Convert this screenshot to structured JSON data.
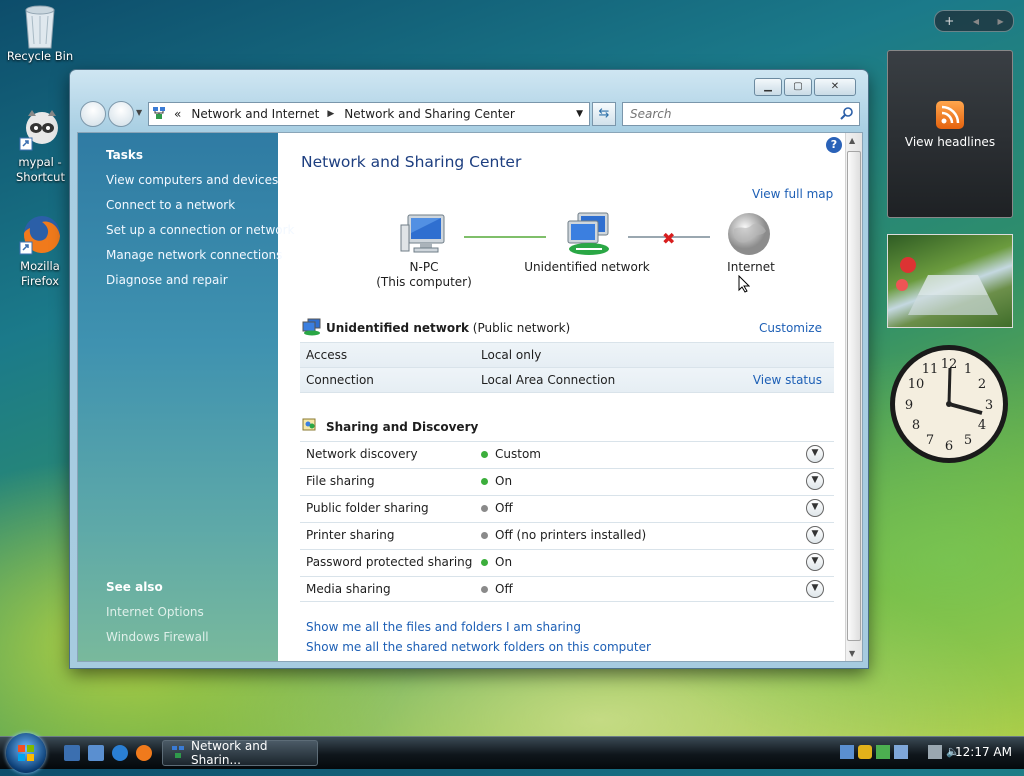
{
  "desktop": {
    "icons": [
      {
        "label": "Recycle Bin"
      },
      {
        "label": "mypal - Shortcut"
      },
      {
        "label": "Mozilla Firefox"
      }
    ]
  },
  "window": {
    "address": {
      "overflow": "«",
      "crumb1": "Network and Internet",
      "crumb2": "Network and Sharing Center"
    },
    "search_placeholder": "Search",
    "sidebar": {
      "tasks_header": "Tasks",
      "tasks": [
        "View computers and devices",
        "Connect to a network",
        "Set up a connection or network",
        "Manage network connections",
        "Diagnose and repair"
      ],
      "see_also_header": "See also",
      "see_also": [
        "Internet Options",
        "Windows Firewall"
      ]
    },
    "main": {
      "title": "Network and Sharing Center",
      "view_full_map": "View full map",
      "map": {
        "computer_name": "N-PC",
        "computer_sub": "(This computer)",
        "network": "Unidentified network",
        "internet": "Internet"
      },
      "network_section": {
        "name": "Unidentified network",
        "type": "(Public network)",
        "customize": "Customize",
        "rows": [
          {
            "key": "Access",
            "value": "Local only"
          },
          {
            "key": "Connection",
            "value": "Local Area Connection",
            "action": "View status"
          }
        ]
      },
      "sharing": {
        "header": "Sharing and Discovery",
        "rows": [
          {
            "key": "Network discovery",
            "value": "Custom",
            "status": "on"
          },
          {
            "key": "File sharing",
            "value": "On",
            "status": "on"
          },
          {
            "key": "Public folder sharing",
            "value": "Off",
            "status": "off"
          },
          {
            "key": "Printer sharing",
            "value": "Off (no printers installed)",
            "status": "off"
          },
          {
            "key": "Password protected sharing",
            "value": "On",
            "status": "on"
          },
          {
            "key": "Media sharing",
            "value": "Off",
            "status": "off"
          }
        ]
      },
      "footer_links": [
        "Show me all the files and folders I am sharing",
        "Show me all the shared network folders on this computer"
      ]
    }
  },
  "gadgets": {
    "feed_label": "View headlines",
    "clock_numbers": [
      "12",
      "1",
      "2",
      "3",
      "4",
      "5",
      "6",
      "7",
      "8",
      "9",
      "10",
      "11"
    ]
  },
  "taskbar": {
    "task_label": "Network and Sharin...",
    "time": "12:17 AM"
  },
  "colors": {
    "status_on": "#3cae3c",
    "status_off": "#8a8a8a",
    "link": "#1d5fb5",
    "title": "#1e3f80"
  }
}
